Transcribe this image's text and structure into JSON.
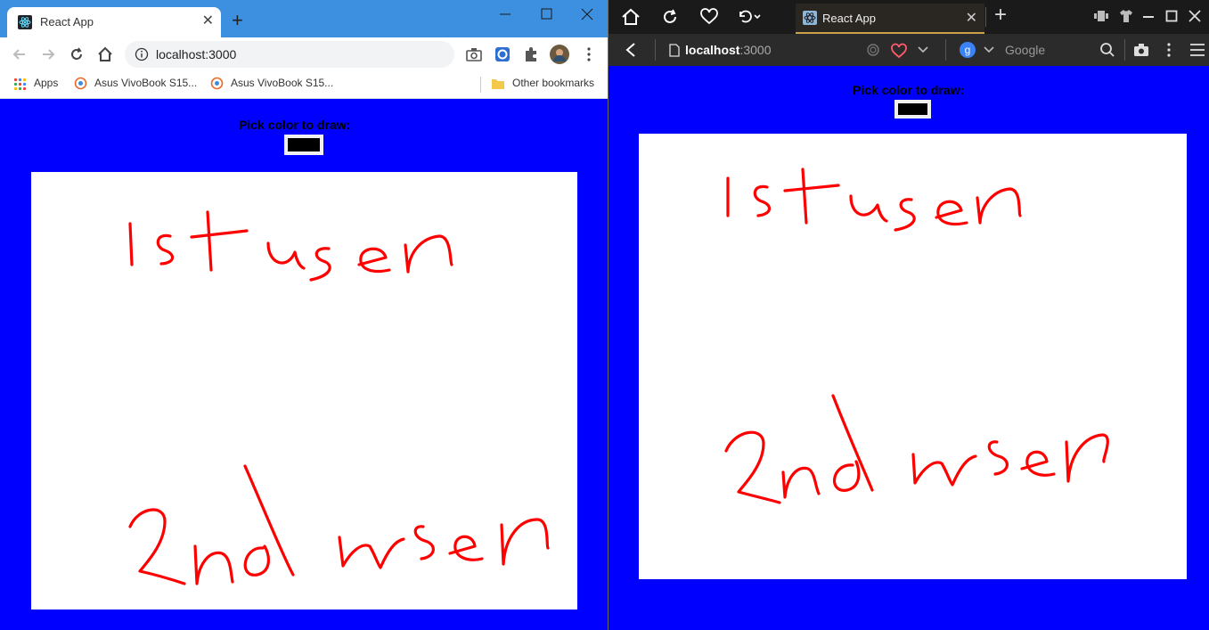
{
  "chrome": {
    "tab_title": "React App",
    "url": "localhost:3000",
    "bookmarks": [
      "Apps",
      "Asus VivoBook S15...",
      "Asus VivoBook S15...",
      "Other bookmarks"
    ]
  },
  "opera": {
    "tab_title": "React App",
    "url_host": "localhost",
    "url_port": ":3000",
    "search_engine": "Google"
  },
  "app": {
    "pick_label": "Pick color to draw:",
    "selected_color": "#000000",
    "stroke_color": "#ff0000"
  }
}
